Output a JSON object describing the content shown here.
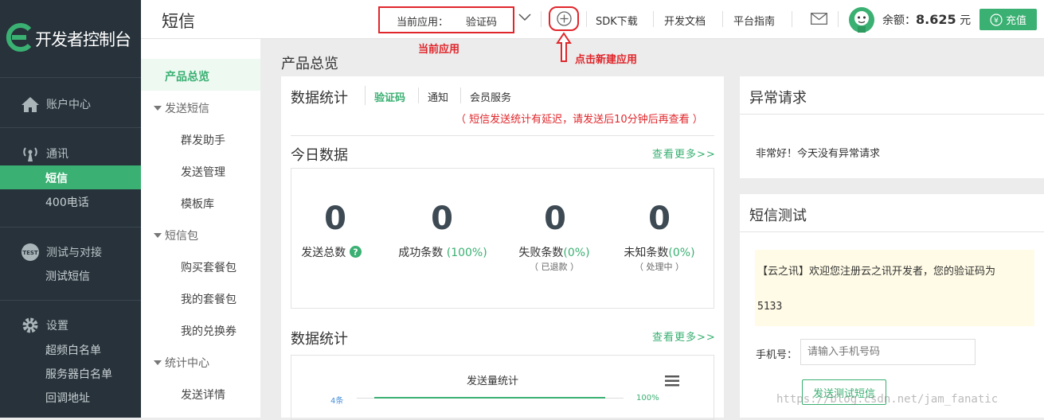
{
  "brand": {
    "title": "开发者控制台",
    "accent": "#3ab072",
    "annotation_color": "#e0262b"
  },
  "sidebar": {
    "account": "账户中心",
    "comm": "通讯",
    "comm_items": [
      "短信",
      "400电话"
    ],
    "test": "测试与对接",
    "test_items": [
      "测试短信"
    ],
    "settings": "设置",
    "settings_items": [
      "超频白名单",
      "服务器白名单",
      "回调地址"
    ]
  },
  "header": {
    "page_title": "短信",
    "current_app_label": "当前应用：",
    "current_app_value": "验证码",
    "links": [
      "SDK下载",
      "开发文档",
      "平台指南"
    ],
    "balance_label": "余额：",
    "balance_value": "8.625",
    "balance_unit": "元",
    "charge_label": "充值"
  },
  "annotations": {
    "current_app": "当前应用",
    "new_app": "点击新建应用"
  },
  "subnav": {
    "overview": "产品总览",
    "send_sms": "发送短信",
    "send_items": [
      "群发助手",
      "发送管理",
      "模板库"
    ],
    "package": "短信包",
    "package_items": [
      "购买套餐包",
      "我的套餐包",
      "我的兑换券"
    ],
    "stats": "统计中心",
    "stats_items": [
      "发送详情"
    ]
  },
  "main": {
    "overview_title": "产品总览",
    "stats_title": "数据统计",
    "tabs": [
      "验证码",
      "通知",
      "会员服务"
    ],
    "delay_note": "（ 短信发送统计有延迟，请发送后10分钟后再查看 ）",
    "today_title": "今日数据",
    "more": "查看更多>>",
    "today": [
      {
        "value": "0",
        "label": "发送总数",
        "pct": "",
        "sub": ""
      },
      {
        "value": "0",
        "label": "成功条数 ",
        "pct": "(100%)",
        "sub": ""
      },
      {
        "value": "0",
        "label": "失败条数",
        "pct": "(0%)",
        "sub": "（ 已退款 ）"
      },
      {
        "value": "0",
        "label": "未知条数",
        "pct": "(0%)",
        "sub": "（ 处理中 ）"
      }
    ],
    "stats2_title": "数据统计",
    "chart_title": "发送量统计",
    "chart_left": "4条",
    "chart_right": "100%"
  },
  "abnormal": {
    "title": "异常请求",
    "message": "非常好！今天没有异常请求"
  },
  "sms_test": {
    "title": "短信测试",
    "message": "【云之讯】欢迎您注册云之讯开发者，您的验证码为",
    "code": "5133",
    "phone_label": "手机号：",
    "phone_placeholder": "请输入手机号码",
    "send_label": "发送测试短信"
  },
  "watermark": "https://blog.csdn.net/jam_fanatic"
}
